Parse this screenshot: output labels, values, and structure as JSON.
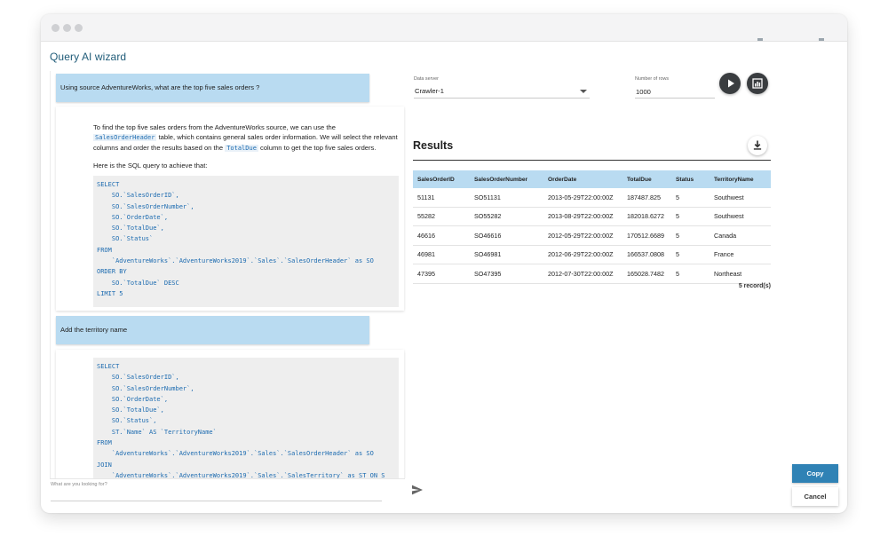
{
  "window": {
    "title": "Query AI wizard"
  },
  "chat": {
    "messages": [
      {
        "role": "user",
        "text": "Using source AdventureWorks, what are the top five sales orders ?"
      },
      {
        "role": "assistant",
        "intro_1": "To find the top five sales orders from the AdventureWorks source, we can use the",
        "code_1": "SalesOrderHeader",
        "intro_2": "table, which contains general sales order information. We will select the relevant columns and order the results based on the",
        "code_2": "TotalDue",
        "intro_3": "column to get the top five sales orders.",
        "lead": "Here is the SQL query to achieve that:",
        "sql": "SELECT\n    SO.`SalesOrderID`,\n    SO.`SalesOrderNumber`,\n    SO.`OrderDate`,\n    SO.`TotalDue`,\n    SO.`Status`\nFROM\n    `AdventureWorks`.`AdventureWorks2019`.`Sales`.`SalesOrderHeader` as SO\nORDER BY\n    SO.`TotalDue` DESC\nLIMIT 5"
      },
      {
        "role": "user",
        "text": "Add the territory name"
      },
      {
        "role": "assistant",
        "sql": "SELECT\n    SO.`SalesOrderID`,\n    SO.`SalesOrderNumber`,\n    SO.`OrderDate`,\n    SO.`TotalDue`,\n    SO.`Status`,\n    ST.`Name` AS `TerritoryName`\nFROM\n    `AdventureWorks`.`AdventureWorks2019`.`Sales`.`SalesOrderHeader` as SO\nJOIN\n    `AdventureWorks`.`AdventureWorks2019`.`Sales`.`SalesTerritory` as ST ON S"
      }
    ],
    "input_placeholder": "What are you looking for?"
  },
  "controls": {
    "data_server_label": "Data server",
    "data_server_value": "Crawler-1",
    "rows_label": "Number of rows",
    "rows_value": "1000"
  },
  "results": {
    "title": "Results",
    "columns": [
      "SalesOrderID",
      "SalesOrderNumber",
      "OrderDate",
      "TotalDue",
      "Status",
      "TerritoryName"
    ],
    "rows": [
      [
        "51131",
        "SO51131",
        "2013-05-29T22:00:00Z",
        "187487.825",
        "5",
        "Southwest"
      ],
      [
        "55282",
        "SO55282",
        "2013-08-29T22:00:00Z",
        "182018.6272",
        "5",
        "Southwest"
      ],
      [
        "46616",
        "SO46616",
        "2012-05-29T22:00:00Z",
        "170512.6689",
        "5",
        "Canada"
      ],
      [
        "46981",
        "SO46981",
        "2012-06-29T22:00:00Z",
        "166537.0808",
        "5",
        "France"
      ],
      [
        "47395",
        "SO47395",
        "2012-07-30T22:00:00Z",
        "165028.7482",
        "5",
        "Northeast"
      ]
    ],
    "record_count": "5 record(s)"
  },
  "footer": {
    "copy_label": "Copy",
    "cancel_label": "Cancel"
  },
  "icons": {
    "play": "play-icon",
    "chart": "chart-icon",
    "download": "download-icon",
    "send": "send-icon",
    "dropdown": "chevron-down-icon"
  },
  "colors": {
    "accent": "#2f82b5",
    "title": "#1f5b78",
    "user_bubble": "#b9dbf1",
    "table_header": "#b9dbf1",
    "code_text": "#1c6bb0",
    "dark_button": "#3a3d40"
  }
}
